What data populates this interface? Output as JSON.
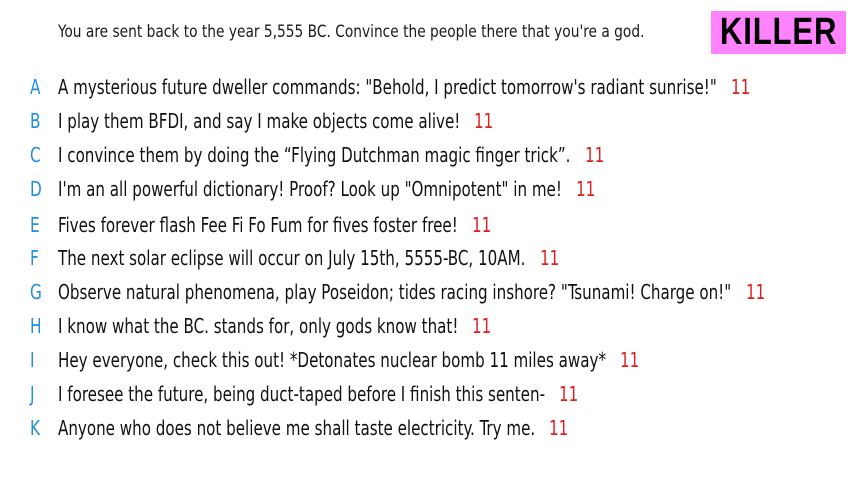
{
  "prompt": "You are sent back to the year 5,555 BC. Convince the people there that you're a god.",
  "badge": "KILLER",
  "colors": {
    "badge_bg": "#ff82ff",
    "letter": "#1f8fdf",
    "score": "#e02020"
  },
  "answers": [
    {
      "letter": "A",
      "text": "A mysterious future dweller commands: \"Behold, I predict tomorrow's radiant sunrise!\"",
      "score": "11"
    },
    {
      "letter": "B",
      "text": "I play them BFDI, and say I make objects come alive!",
      "score": "11"
    },
    {
      "letter": "C",
      "text": "I convince them by doing the “Flying Dutchman magic finger trick”.",
      "score": "11"
    },
    {
      "letter": "D",
      "text": "I'm an all powerful dictionary! Proof? Look up \"Omnipotent\" in me!",
      "score": "11"
    },
    {
      "letter": "E",
      "text": "Fives forever flash Fee Fi Fo Fum for fives foster free!",
      "score": "11"
    },
    {
      "letter": "F",
      "text": "The next solar eclipse will occur on July 15th, 5555-BC, 10AM.",
      "score": "11"
    },
    {
      "letter": "G",
      "text": "Observe natural phenomena, play Poseidon; tides racing inshore? \"Tsunami! Charge on!\"",
      "score": "11"
    },
    {
      "letter": "H",
      "text": "I know what the BC. stands for, only gods know that!",
      "score": "11"
    },
    {
      "letter": "I",
      "text": "Hey everyone, check this out! *Detonates nuclear bomb 11 miles away*",
      "score": "11"
    },
    {
      "letter": "J",
      "text": "I foresee the future, being duct-taped before I finish this senten-",
      "score": "11"
    },
    {
      "letter": "K",
      "text": "Anyone who does not believe me shall taste electricity. Try me.",
      "score": "11"
    }
  ]
}
